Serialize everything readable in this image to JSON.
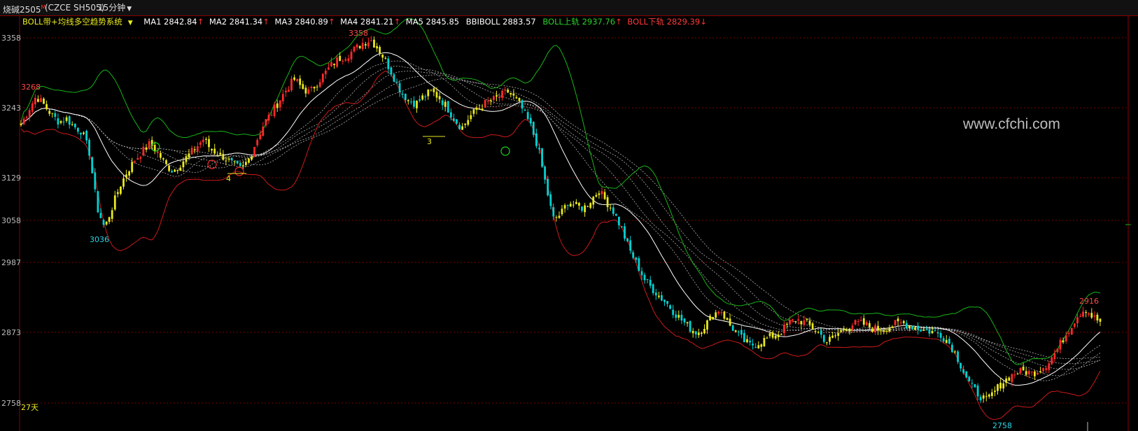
{
  "window": {
    "symbol": "烧碱2505",
    "symbol_sup": "M",
    "contract": "(CZCE SH505)",
    "period": "15分钟"
  },
  "indicators": {
    "system_name": "BOLL带+均线多空趋势系统",
    "ma1": "MA1 2842.84",
    "ma2": "MA2 2841.34",
    "ma3": "MA3 2840.89",
    "ma4": "MA4 2841.21",
    "ma5": "MA5 2845.85",
    "bbiboll": "BBIBOLL 2883.57",
    "boll_up": "BOLL上轨 2937.76",
    "boll_down": "BOLL下轨 2829.39"
  },
  "watermark": "www.cfchi.com",
  "colors": {
    "background": "#000000",
    "up_candle": "#ff2a2a",
    "down_candle": "#00d2d2",
    "neutral_candle": "#e8e820",
    "boll_upper": "#18b418",
    "boll_lower": "#cc1a1a",
    "mid_line": "#ffffff",
    "ma_lines": "#b0b0b0",
    "grid": "#7a0000"
  },
  "chart_data": {
    "type": "candlestick",
    "y_axis_ticks": [
      3358,
      3243,
      3129,
      3058,
      2987,
      2873,
      2758
    ],
    "ylim": [
      2758,
      3358
    ],
    "grid": true,
    "period_label": "27天",
    "annotations": [
      {
        "text": "3268",
        "kind": "high",
        "value": 3268
      },
      {
        "text": "3036",
        "kind": "low",
        "value": 3036
      },
      {
        "text": "3358",
        "kind": "high",
        "value": 3358
      },
      {
        "text": "2758",
        "kind": "low",
        "value": 2758
      },
      {
        "text": "2916",
        "kind": "high",
        "value": 2916
      },
      {
        "text": "3",
        "kind": "marker"
      },
      {
        "text": "4",
        "kind": "marker"
      }
    ],
    "price_path": [
      3215,
      3240,
      3262,
      3248,
      3232,
      3220,
      3225,
      3212,
      3205,
      3170,
      3080,
      3045,
      3080,
      3115,
      3140,
      3158,
      3172,
      3185,
      3170,
      3150,
      3140,
      3152,
      3165,
      3178,
      3192,
      3175,
      3168,
      3160,
      3150,
      3142,
      3160,
      3190,
      3218,
      3235,
      3255,
      3275,
      3290,
      3275,
      3268,
      3285,
      3300,
      3315,
      3325,
      3330,
      3340,
      3350,
      3355,
      3340,
      3320,
      3295,
      3270,
      3255,
      3250,
      3262,
      3270,
      3260,
      3245,
      3225,
      3210,
      3228,
      3240,
      3250,
      3255,
      3262,
      3270,
      3258,
      3240,
      3215,
      3180,
      3120,
      3060,
      3068,
      3090,
      3082,
      3078,
      3092,
      3108,
      3090,
      3072,
      3045,
      3010,
      2985,
      2960,
      2945,
      2932,
      2920,
      2905,
      2892,
      2880,
      2872,
      2885,
      2900,
      2912,
      2888,
      2875,
      2860,
      2852,
      2856,
      2862,
      2868,
      2874,
      2888,
      2894,
      2890,
      2882,
      2872,
      2858,
      2866,
      2876,
      2884,
      2888,
      2886,
      2880,
      2878,
      2882,
      2886,
      2888,
      2884,
      2880,
      2876,
      2874,
      2870,
      2858,
      2838,
      2810,
      2785,
      2772,
      2762,
      2775,
      2790,
      2800,
      2808,
      2810,
      2806,
      2812,
      2822,
      2838,
      2860,
      2880,
      2900,
      2912,
      2898,
      2890
    ]
  }
}
